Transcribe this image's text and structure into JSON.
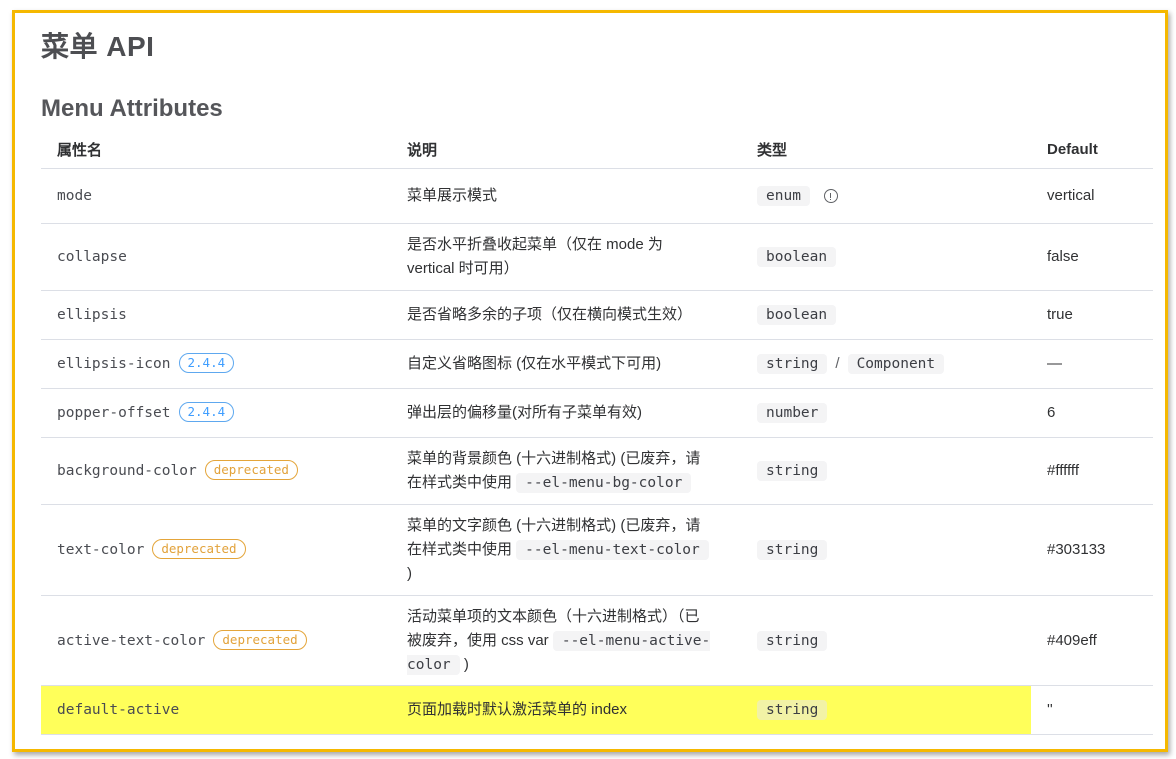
{
  "page": {
    "title": "菜单 API",
    "section_title": "Menu Attributes"
  },
  "table": {
    "headers": {
      "name": "属性名",
      "desc": "说明",
      "type": "类型",
      "default": "Default"
    },
    "rows": {
      "mode": {
        "name": "mode",
        "desc": "菜单展示模式",
        "type": "enum",
        "default": "vertical"
      },
      "collapse": {
        "name": "collapse",
        "desc": "是否水平折叠收起菜单（仅在 mode 为 vertical 时可用）",
        "type": "boolean",
        "default": "false"
      },
      "ellipsis": {
        "name": "ellipsis",
        "desc": "是否省略多余的子项（仅在横向模式生效）",
        "type": "boolean",
        "default": "true"
      },
      "ellipsis_icon": {
        "name": "ellipsis-icon",
        "badge": "2.4.4",
        "desc": "自定义省略图标 (仅在水平模式下可用)",
        "type": "string",
        "type2": "Component",
        "type_sep": "/",
        "default": "—"
      },
      "popper_offset": {
        "name": "popper-offset",
        "badge": "2.4.4",
        "desc": "弹出层的偏移量(对所有子菜单有效)",
        "type": "number",
        "default": "6"
      },
      "background_color": {
        "name": "background-color",
        "badge": "deprecated",
        "desc_before": "菜单的背景颜色 (十六进制格式) (已废弃，请在样式类中使用 ",
        "desc_code": "--el-menu-bg-color",
        "desc_after": "",
        "type": "string",
        "default": "#ffffff"
      },
      "text_color": {
        "name": "text-color",
        "badge": "deprecated",
        "desc_before": "菜单的文字颜色 (十六进制格式) (已废弃，请在样式类中使用 ",
        "desc_code": "--el-menu-text-color",
        "desc_after": " )",
        "type": "string",
        "default": "#303133"
      },
      "active_text_color": {
        "name": "active-text-color",
        "badge": "deprecated",
        "desc_before": "活动菜单项的文本颜色（十六进制格式）（已被废弃，使用 css var ",
        "desc_code": "--el-menu-active-color",
        "desc_after": " )",
        "type": "string",
        "default": "#409eff"
      },
      "default_active": {
        "name": "default-active",
        "desc": "页面加载时默认激活菜单的 index",
        "type": "string",
        "default": "''"
      }
    }
  },
  "icons": {
    "enum_info": "info-circle-icon"
  },
  "colors": {
    "frame_border": "#f5b800",
    "highlight": "#ffff5a",
    "version_badge": "#409eff",
    "deprecated_badge": "#e2a23a"
  }
}
